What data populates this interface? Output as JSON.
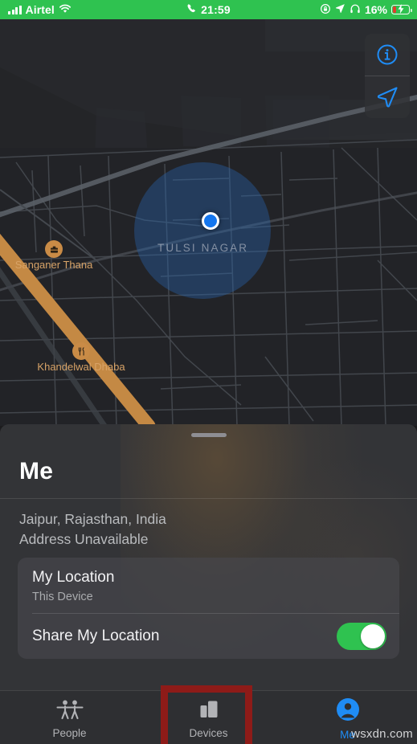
{
  "status_bar": {
    "signal_icon": "signal-bars-icon",
    "carrier": "Airtel",
    "wifi_icon": "wifi-icon",
    "call_icon": "phone-call-icon",
    "time": "21:59",
    "rotation_lock_icon": "rotation-lock-icon",
    "location_arrow_icon": "location-arrow-icon",
    "headphones_icon": "headphones-icon",
    "battery_percent": "16%",
    "battery_icon": "battery-charging-icon",
    "background_color": "#2fc250",
    "text_color": "#ffffff"
  },
  "map": {
    "controls": {
      "info_icon": "info-circle-icon",
      "tracking_icon": "location-arrow-icon"
    },
    "user_location_icon": "blue-location-dot",
    "neighborhood_label": "TULSI NAGAR",
    "pois": [
      {
        "name": "Sanganer Thana",
        "icon": "government-building-icon",
        "color": "#d8a367"
      },
      {
        "name": "Khandelwal Dhaba",
        "icon": "restaurant-fork-knife-icon",
        "color": "#d8a367"
      }
    ],
    "accent_color": "#1f8cf5",
    "road_color": "#c98b46"
  },
  "sheet": {
    "title": "Me",
    "address_line1": "Jaipur, Rajasthan, India",
    "address_line2": "Address Unavailable",
    "card": {
      "my_location_label": "My Location",
      "my_location_value": "This Device",
      "share_label": "Share My Location",
      "share_enabled": "on",
      "toggle_color": "#2fc250"
    }
  },
  "tabbar": {
    "tabs": [
      {
        "label": "People",
        "icon": "two-people-icon",
        "selected": "false"
      },
      {
        "label": "Devices",
        "icon": "devices-icon",
        "selected": "false"
      },
      {
        "label": "Me",
        "icon": "person-circle-icon",
        "selected": "true"
      }
    ],
    "selected_color": "#1f8cf5",
    "highlight_color": "#8e1b18"
  },
  "watermark": "wsxdn.com"
}
